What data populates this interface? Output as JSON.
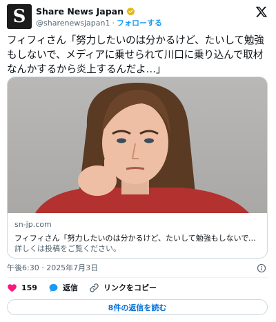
{
  "account": {
    "display_name": "Share News Japan",
    "handle": "@sharenewsjapan1",
    "separator": "·",
    "follow_label": "フォローする",
    "avatar_letter": "S"
  },
  "tweet": {
    "text": "フィフィさん「努力したいのは分かるけど、たいして勉強もしないで、メディアに乗せられて川口に乗り込んで取材なんかするから炎上するんだよ…」"
  },
  "link_card": {
    "image_alt": "woman pointing at camera",
    "domain": "sn-jp.com",
    "title": "フィフィさん「努力したいのは分かるけど、たいして勉強もしないで、…",
    "description": "詳しくは投稿をご覧ください。"
  },
  "timestamp": "午後6:30 · 2025年7月3日",
  "actions": {
    "likes": "159",
    "reply_label": "返信",
    "copy_link_label": "リンクをコピー"
  },
  "read_replies_label": "8件の返信を読む",
  "colors": {
    "accent": "#1d9bf0",
    "like": "#f91880",
    "verified_gold": "#e2b719"
  }
}
